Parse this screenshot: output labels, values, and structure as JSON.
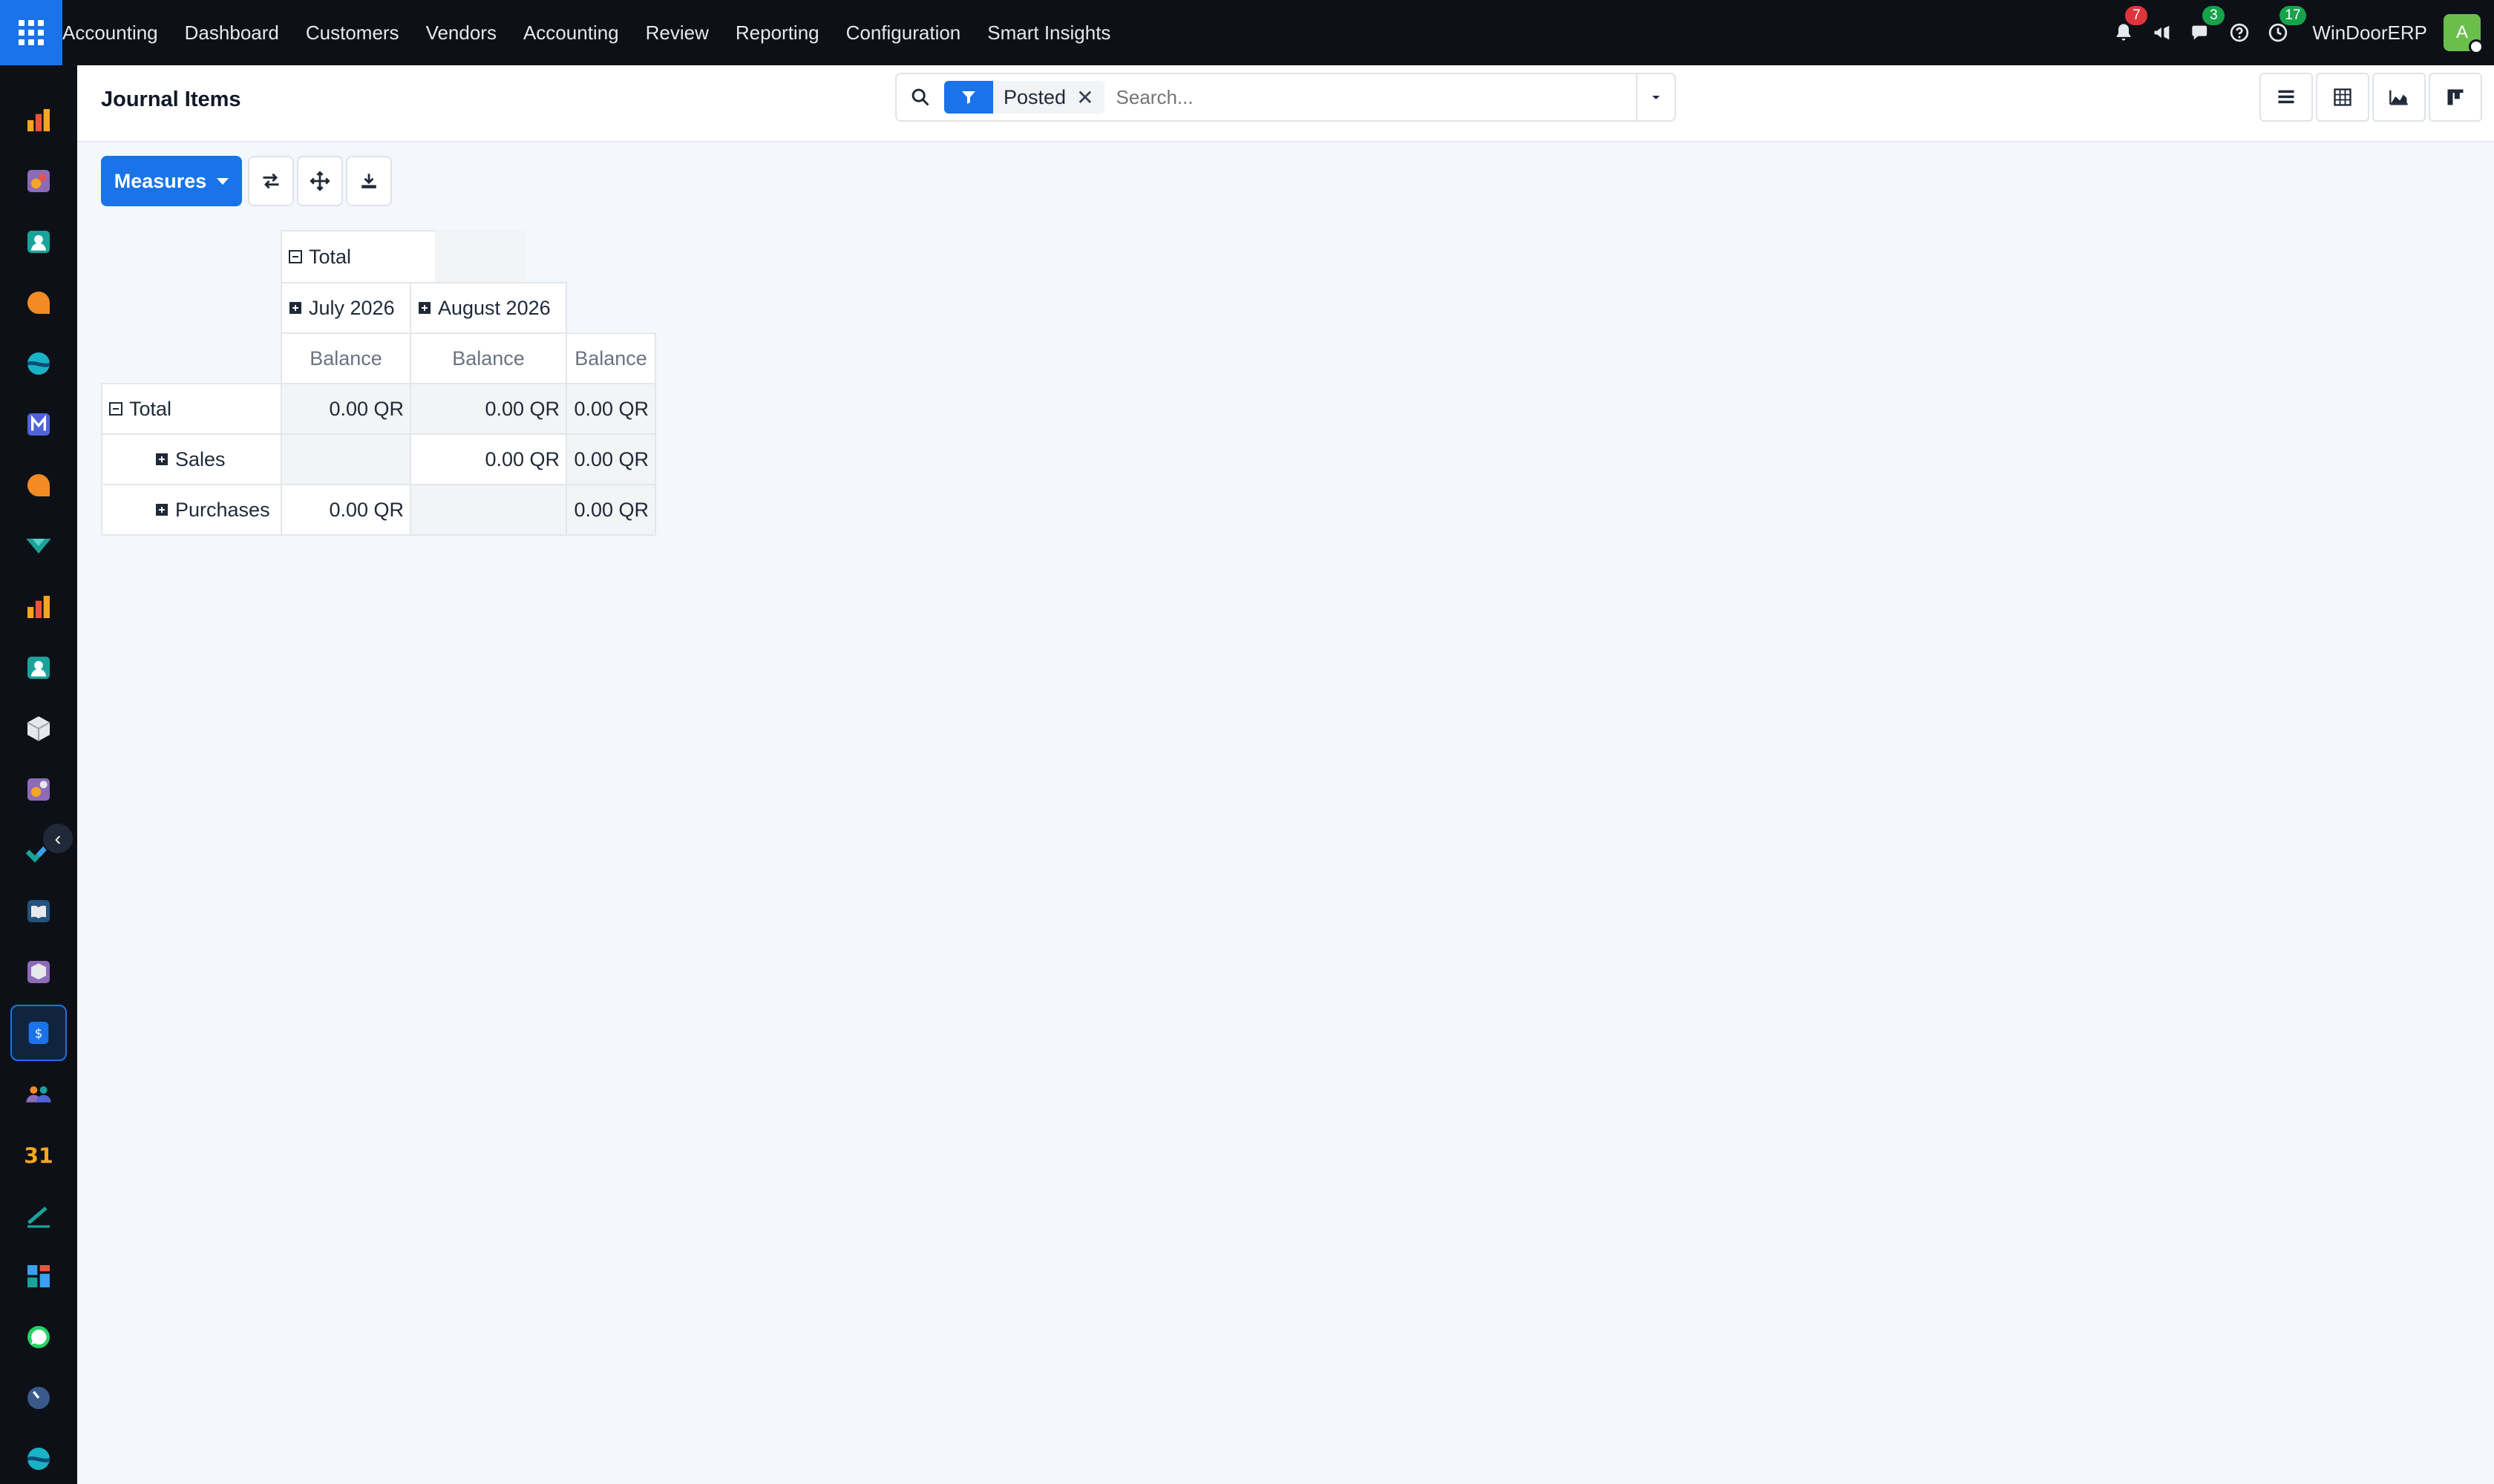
{
  "app": {
    "menu": [
      "Accounting",
      "Dashboard",
      "Customers",
      "Vendors",
      "Accounting",
      "Review",
      "Reporting",
      "Configuration",
      "Smart Insights"
    ],
    "notifications": {
      "bell_count": "7",
      "chat_count": "3",
      "activity_count": "17"
    },
    "company": "WinDoorERP",
    "avatar_initial": "A"
  },
  "sidebar": {
    "icons": [
      "reports-icon",
      "sales-icon",
      "contacts-icon",
      "discuss-icon",
      "website-icon",
      "email-marketing-icon",
      "livechat-icon",
      "project-icon",
      "dashboard-icon",
      "employees-icon",
      "inventory-icon",
      "manufacturing-icon",
      "todo-icon",
      "knowledge-icon",
      "purchase-icon",
      "accounting-icon",
      "team-icon",
      "calendar-icon",
      "sign-icon",
      "spreadsheet-icon",
      "whatsapp-icon",
      "timesheet-icon",
      "website-2-icon"
    ],
    "active_index": 15
  },
  "control": {
    "title": "Journal Items",
    "facet_label": "Posted",
    "search_placeholder": "Search..."
  },
  "toolbar": {
    "measures_label": "Measures"
  },
  "pivot": {
    "col_total": "Total",
    "col_groups": [
      "July 2026",
      "August 2026"
    ],
    "measure": "Balance",
    "rows": [
      {
        "label": "Total",
        "values": [
          "0.00 QR",
          "0.00 QR",
          "0.00 QR"
        ]
      },
      {
        "label": "Sales",
        "values": [
          "",
          "0.00 QR",
          "0.00 QR"
        ]
      },
      {
        "label": "Purchases",
        "values": [
          "0.00 QR",
          "",
          "0.00 QR"
        ]
      }
    ]
  },
  "colors": {
    "accent": "#1a73e8",
    "navbar": "#0d1117",
    "badge_red": "#e0343c",
    "badge_green": "#16a34a"
  }
}
